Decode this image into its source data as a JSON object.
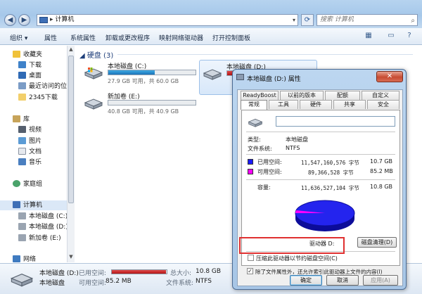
{
  "window": {
    "address": "计算机",
    "search_placeholder": "搜索 计算机",
    "back_icon": "back-arrow-icon",
    "forward_icon": "forward-arrow-icon"
  },
  "toolbar": {
    "organize": "组织 ▾",
    "properties": "属性",
    "system_properties": "系统属性",
    "uninstall": "卸载或更改程序",
    "map_drive": "映射网络驱动器",
    "control_panel": "打开控制面板"
  },
  "nav": {
    "favorites": "收藏夹",
    "downloads": "下载",
    "desktop": "桌面",
    "recent": "最近访问的位置",
    "downloads2345": "2345下载",
    "libraries": "库",
    "videos": "视频",
    "pictures": "图片",
    "documents": "文档",
    "music": "音乐",
    "homegroup": "家庭组",
    "computer": "计算机",
    "drive_c": "本地磁盘 (C:)",
    "drive_d": "本地磁盘 (D:)",
    "drive_e": "新加卷 (E:)",
    "network": "网络"
  },
  "content": {
    "group_header": "硬盘 (3)",
    "drives": [
      {
        "name": "本地磁盘 (C:)",
        "free": "27.9 GB 可用，共 60.0 GB",
        "used_fraction": 0.535
      },
      {
        "name": "本地磁盘 (D:)",
        "used_fraction": 0.112
      },
      {
        "name": "新加卷 (E:)",
        "free": "40.8 GB 可用，共 40.9 GB",
        "used_fraction": 0.003
      }
    ]
  },
  "details": {
    "name": "本地磁盘 (D:)",
    "type": "本地磁盘",
    "used_label": "已用空间:",
    "free_label": "可用空间:",
    "free_value": "85.2 MB",
    "total_label": "总大小:",
    "total_value": "10.8 GB",
    "fs_label": "文件系统:",
    "fs_value": "NTFS",
    "used_fraction": 0.992
  },
  "dialog": {
    "title": "本地磁盘 (D:) 属性",
    "close": "✕",
    "tabs_row1": [
      "ReadyBoost",
      "以前的版本",
      "配额",
      "自定义"
    ],
    "tabs_row2": [
      "常规",
      "工具",
      "硬件",
      "共享",
      "安全"
    ],
    "type_label": "类型:",
    "type_value": "本地磁盘",
    "fs_label": "文件系统:",
    "fs_value": "NTFS",
    "used_label": "已用空间:",
    "used_bytes": "11,547,160,576 字节",
    "used_size": "10.7 GB",
    "free_label": "可用空间:",
    "free_bytes": "89,366,528 字节",
    "free_size": "85.2 MB",
    "capacity_label": "容量:",
    "capacity_bytes": "11,636,527,104 字节",
    "capacity_size": "10.8 GB",
    "drive_label": "驱动器 D:",
    "cleanup": "磁盘清理(D)",
    "compress": "压缩此驱动器以节约磁盘空间(C)",
    "index": "除了文件属性外，还允许索引此驱动器上文件的内容(I)",
    "ok": "确定",
    "cancel": "取消",
    "apply": "应用(A)",
    "used_color": "#1a1aff",
    "free_color": "#ff00ff"
  }
}
